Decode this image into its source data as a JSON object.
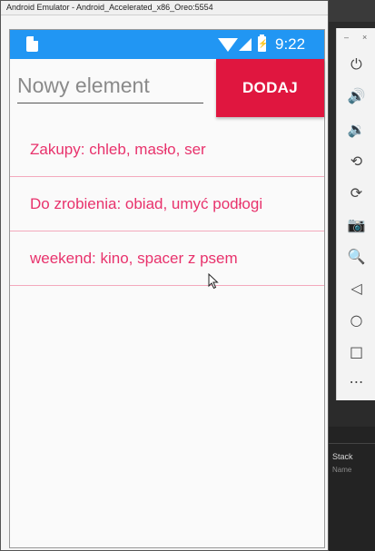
{
  "window": {
    "title": "Android Emulator - Android_Accelerated_x86_Oreo:5554"
  },
  "statusbar": {
    "time": "9:22"
  },
  "form": {
    "placeholder": "Nowy element",
    "add_label": "DODAJ"
  },
  "items": [
    "Zakupy: chleb, masło, ser",
    "Do zrobienia: obiad, umyć podłogi",
    "weekend: kino, spacer z psem"
  ],
  "ide": {
    "stack_label": "Stack",
    "name_label": "Name"
  },
  "toolbar": {
    "minimize": "–",
    "close": "×",
    "icons": [
      "power-icon",
      "volume-up-icon",
      "volume-down-icon",
      "rotate-left-icon",
      "rotate-right-icon",
      "camera-icon",
      "zoom-icon",
      "back-icon",
      "home-icon",
      "overview-icon",
      "more-icon"
    ]
  },
  "colors": {
    "accent": "#e0163f",
    "status_bar": "#2196f3",
    "item_text": "#e8326c",
    "divider": "#f3a9bd"
  }
}
